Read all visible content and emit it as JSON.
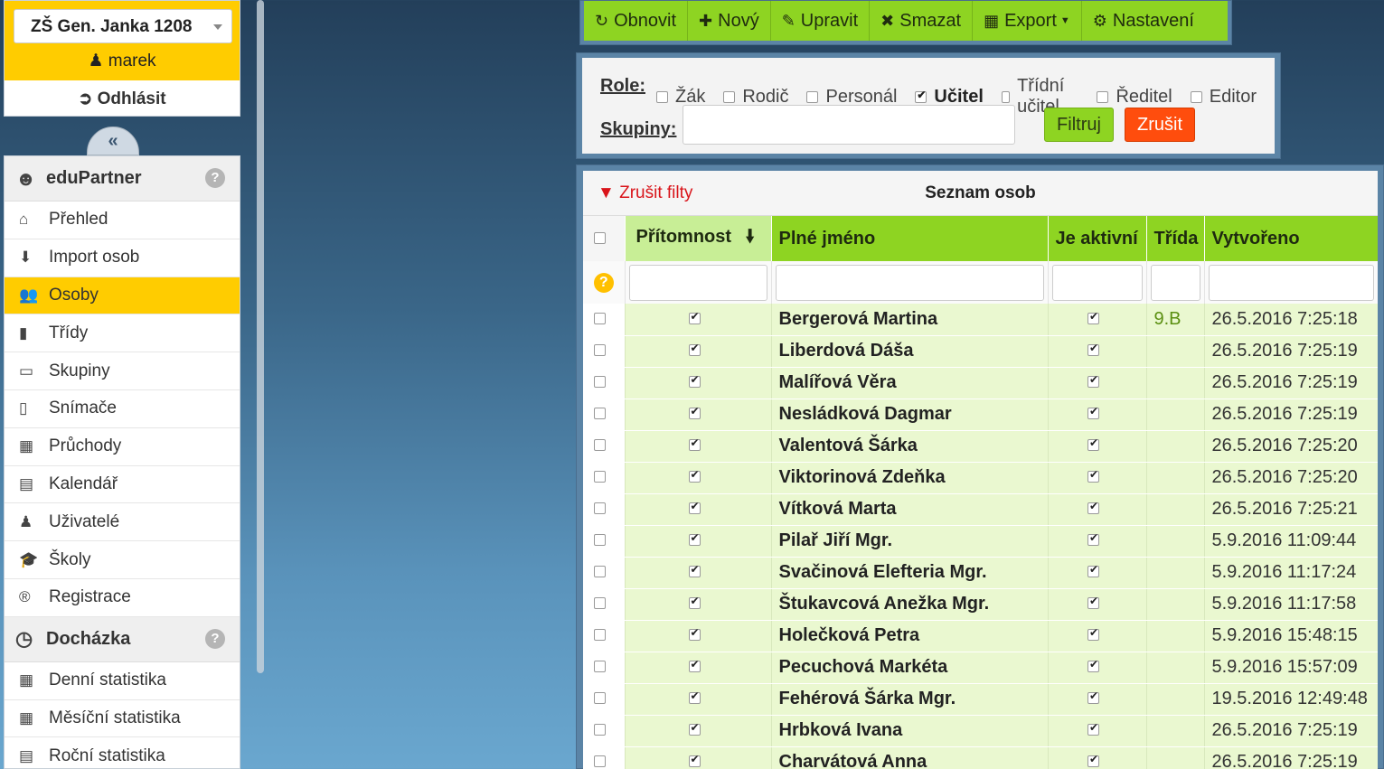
{
  "header": {
    "school": "ZŠ Gen. Janka 1208",
    "user": "marek",
    "logout": "Odhlásit",
    "collapse": "«"
  },
  "sidebar": {
    "section1": {
      "title": "eduPartner",
      "help": "?"
    },
    "items": [
      {
        "label": "Přehled",
        "icon": "home-icon",
        "glyph": "⌂"
      },
      {
        "label": "Import osob",
        "icon": "download-icon",
        "glyph": "⬇"
      },
      {
        "label": "Osoby",
        "icon": "users-icon",
        "glyph": "👥"
      },
      {
        "label": "Třídy",
        "icon": "book-icon",
        "glyph": "▮"
      },
      {
        "label": "Skupiny",
        "icon": "folder-icon",
        "glyph": "▭"
      },
      {
        "label": "Snímače",
        "icon": "mobile-icon",
        "glyph": "▯"
      },
      {
        "label": "Průchody",
        "icon": "table-icon",
        "glyph": "▦"
      },
      {
        "label": "Kalendář",
        "icon": "calendar-icon",
        "glyph": "▤"
      },
      {
        "label": "Uživatelé",
        "icon": "user-secret-icon",
        "glyph": "♟"
      },
      {
        "label": "Školy",
        "icon": "graduation-cap-icon",
        "glyph": "🎓"
      },
      {
        "label": "Registrace",
        "icon": "registered-icon",
        "glyph": "®"
      }
    ],
    "section2": {
      "title": "Docházka",
      "help": "?"
    },
    "items2": [
      {
        "label": "Denní statistika",
        "icon": "calendar-icon",
        "glyph": "▦"
      },
      {
        "label": "Měsíční statistika",
        "icon": "calendar-icon",
        "glyph": "▦"
      },
      {
        "label": "Roční statistika",
        "icon": "calendar-icon",
        "glyph": "▤"
      }
    ]
  },
  "toolbar": {
    "refresh": "Obnovit",
    "new": "Nový",
    "edit": "Upravit",
    "delete": "Smazat",
    "export": "Export",
    "settings": "Nastavení"
  },
  "filter": {
    "role_label": "Role:",
    "roles": [
      {
        "label": "Žák",
        "checked": false
      },
      {
        "label": "Rodič",
        "checked": false
      },
      {
        "label": "Personál",
        "checked": false
      },
      {
        "label": "Učitel",
        "checked": true
      },
      {
        "label": "Třídní učitel",
        "checked": false
      },
      {
        "label": "Ředitel",
        "checked": false
      },
      {
        "label": "Editor",
        "checked": false
      }
    ],
    "groups_label": "Skupiny:",
    "groups_value": "",
    "apply": "Filtruj",
    "cancel": "Zrušit"
  },
  "grid": {
    "clear_filters": "Zrušit filty",
    "title": "Seznam osob",
    "columns": [
      "Přítomnost",
      "Plné jméno",
      "Je aktivní",
      "Třída",
      "Vytvořeno"
    ],
    "rows": [
      {
        "present": true,
        "name": "Bergerová Martina",
        "active": true,
        "class": "9.B",
        "created": "26.5.2016 7:25:18"
      },
      {
        "present": true,
        "name": "Liberdová Dáša",
        "active": true,
        "class": "",
        "created": "26.5.2016 7:25:19"
      },
      {
        "present": true,
        "name": "Malířová Věra",
        "active": true,
        "class": "",
        "created": "26.5.2016 7:25:19"
      },
      {
        "present": true,
        "name": "Nesládková Dagmar",
        "active": true,
        "class": "",
        "created": "26.5.2016 7:25:19"
      },
      {
        "present": true,
        "name": "Valentová Šárka",
        "active": true,
        "class": "",
        "created": "26.5.2016 7:25:20"
      },
      {
        "present": true,
        "name": "Viktorinová Zdeňka",
        "active": true,
        "class": "",
        "created": "26.5.2016 7:25:20"
      },
      {
        "present": true,
        "name": "Vítková Marta",
        "active": true,
        "class": "",
        "created": "26.5.2016 7:25:21"
      },
      {
        "present": true,
        "name": "Pilař Jiří Mgr.",
        "active": true,
        "class": "",
        "created": "5.9.2016 11:09:44"
      },
      {
        "present": true,
        "name": "Svačinová Elefteria Mgr.",
        "active": true,
        "class": "",
        "created": "5.9.2016 11:17:24"
      },
      {
        "present": true,
        "name": "Štukavcová Anežka Mgr.",
        "active": true,
        "class": "",
        "created": "5.9.2016 11:17:58"
      },
      {
        "present": true,
        "name": "Holečková Petra",
        "active": true,
        "class": "",
        "created": "5.9.2016 15:48:15"
      },
      {
        "present": true,
        "name": "Pecuchová Markéta",
        "active": true,
        "class": "",
        "created": "5.9.2016 15:57:09"
      },
      {
        "present": true,
        "name": "Fehérová Šárka Mgr.",
        "active": true,
        "class": "",
        "created": "19.5.2016 12:49:48"
      },
      {
        "present": true,
        "name": "Hrbková Ivana",
        "active": true,
        "class": "",
        "created": "26.5.2016 7:25:19"
      },
      {
        "present": true,
        "name": "Charvátová Anna",
        "active": true,
        "class": "",
        "created": "26.5.2016 7:25:19"
      }
    ]
  },
  "colors": {
    "accent_green": "#8ed422",
    "highlight_yellow": "#ffcc00",
    "danger": "#ff4d0d",
    "row_bg": "#eaf8d0"
  }
}
